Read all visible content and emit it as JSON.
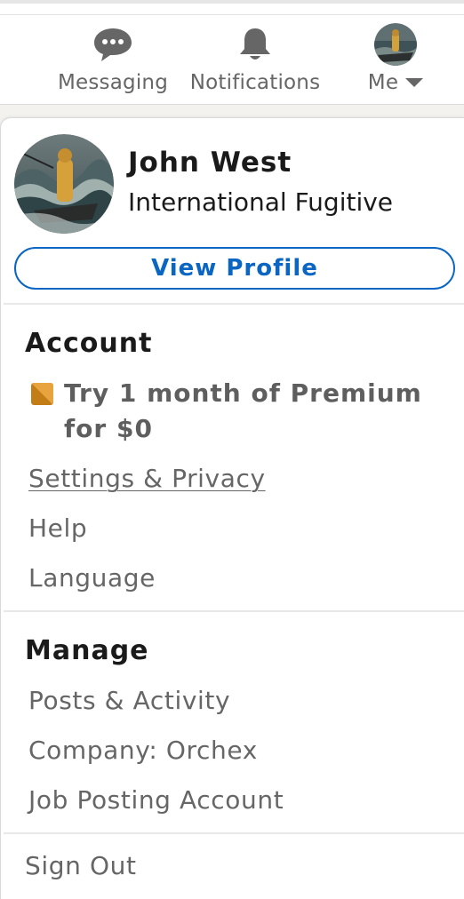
{
  "nav": {
    "messaging": {
      "label": "Messaging",
      "icon": "messaging-icon"
    },
    "notifications": {
      "label": "Notifications",
      "icon": "bell-icon"
    },
    "me": {
      "label": "Me",
      "icon": "chevron-down-icon"
    }
  },
  "profile": {
    "name": "John West",
    "headline": "International Fugitive",
    "view_profile_label": "View Profile"
  },
  "account": {
    "title": "Account",
    "premium_line1": "Try 1 month of Premium",
    "premium_line2": "for $0",
    "items": [
      {
        "label": "Settings & Privacy"
      },
      {
        "label": "Help"
      },
      {
        "label": "Language"
      }
    ]
  },
  "manage": {
    "title": "Manage",
    "items": [
      {
        "label": "Posts & Activity"
      },
      {
        "label": "Company: Orchex"
      },
      {
        "label": "Job Posting Account"
      }
    ]
  },
  "sign_out_label": "Sign Out",
  "colors": {
    "accent": "#0a66c2",
    "premium": "#c37d16",
    "text_muted": "#666666"
  }
}
